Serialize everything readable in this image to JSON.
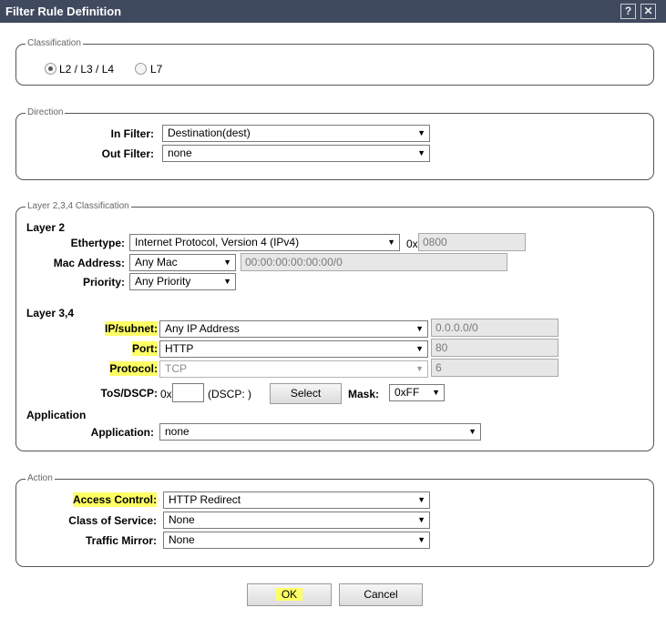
{
  "title": "Filter Rule Definition",
  "title_buttons": {
    "help": "?",
    "close": "✕"
  },
  "classification": {
    "legend": "Classification",
    "options": [
      {
        "label": "L2 / L3 / L4",
        "selected": true
      },
      {
        "label": "L7",
        "selected": false
      }
    ]
  },
  "direction": {
    "legend": "Direction",
    "in_filter_label": "In Filter:",
    "in_filter_value": "Destination(dest)",
    "out_filter_label": "Out Filter:",
    "out_filter_value": "none"
  },
  "layer234": {
    "legend": "Layer 2,3,4 Classification",
    "layer2_heading": "Layer 2",
    "ethertype_label": "Ethertype:",
    "ethertype_value": "Internet Protocol, Version 4 (IPv4)",
    "ethertype_prefix": "0x",
    "ethertype_hex": "0800",
    "mac_label": "Mac Address:",
    "mac_value": "Any Mac",
    "mac_text": "00:00:00:00:00:00/0",
    "priority_label": "Priority:",
    "priority_value": "Any Priority",
    "layer34_heading": "Layer 3,4",
    "ip_label": "IP/subnet:",
    "ip_value": "Any IP Address",
    "ip_text": "0.0.0.0/0",
    "port_label": "Port:",
    "port_value": "HTTP",
    "port_text": "80",
    "protocol_label": "Protocol:",
    "protocol_value": "TCP",
    "protocol_text": "6",
    "tos_label": "ToS/DSCP:",
    "tos_prefix": "0x",
    "tos_value": "",
    "dscp_text": "(DSCP: )",
    "select_button": "Select",
    "mask_label": "Mask:",
    "mask_value": "0xFF",
    "application_heading": "Application",
    "application_label": "Application:",
    "application_value": "none"
  },
  "action": {
    "legend": "Action",
    "access_control_label": "Access Control:",
    "access_control_value": "HTTP Redirect",
    "cos_label": "Class of Service:",
    "cos_value": "None",
    "mirror_label": "Traffic Mirror:",
    "mirror_value": "None"
  },
  "footer": {
    "ok": "OK",
    "cancel": "Cancel"
  },
  "colors": {
    "titlebar": "#404a5e",
    "highlight": "#ffff66"
  }
}
